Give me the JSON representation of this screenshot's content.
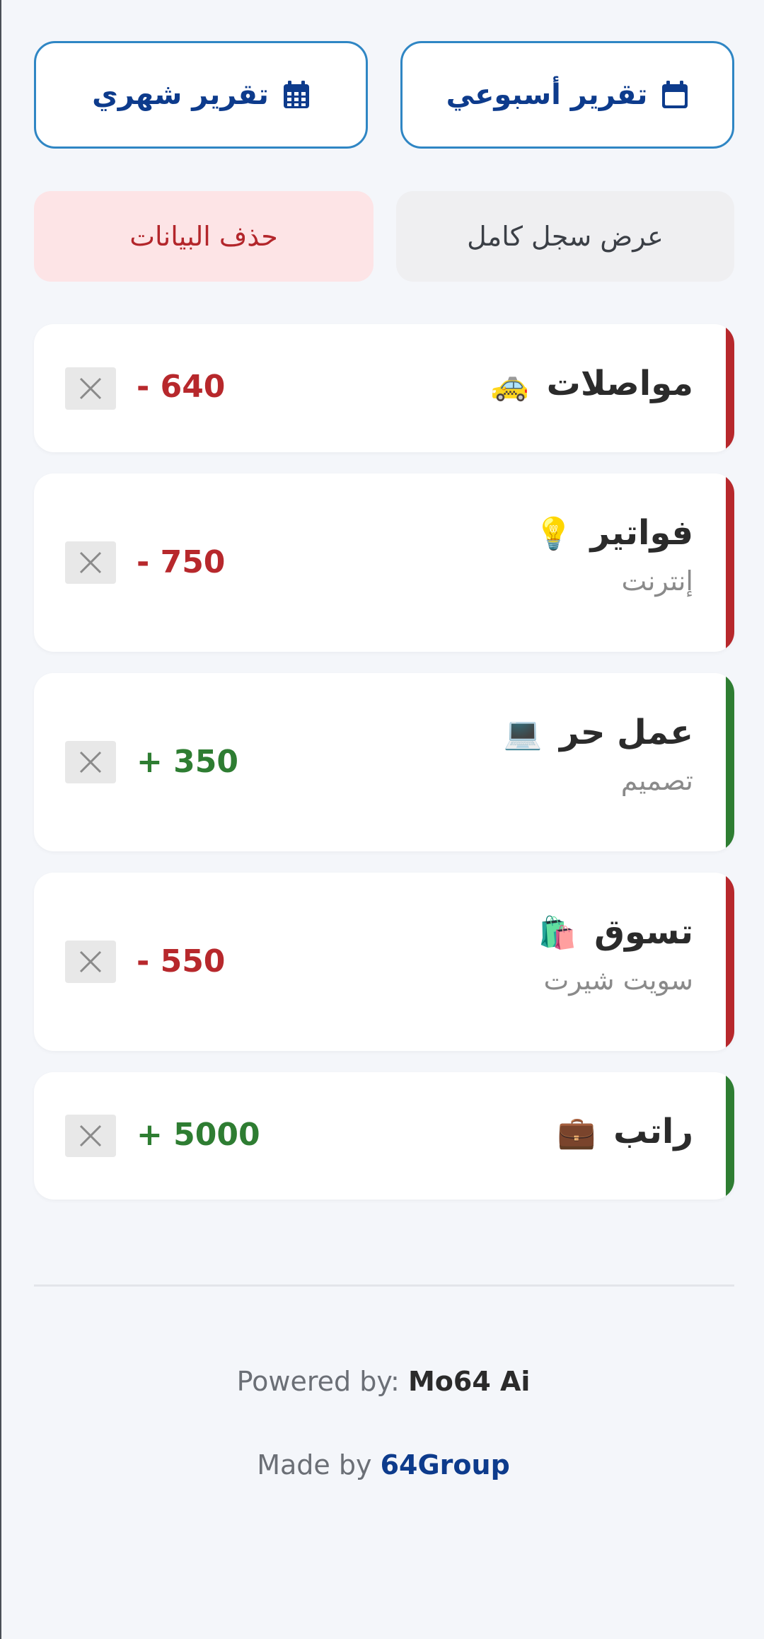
{
  "reports": {
    "weekly_label": "تقرير أسبوعي",
    "monthly_label": "تقرير شهري",
    "icon": "calendar-icon",
    "color": "#0d3b8c"
  },
  "actions": {
    "history_label": "عرض سجل كامل",
    "delete_label": "حذف البيانات"
  },
  "transactions": [
    {
      "title": "مواصلات",
      "emoji": "🚕",
      "note": "",
      "amount": "- 640",
      "type": "expense"
    },
    {
      "title": "فواتير",
      "emoji": "💡",
      "note": "إنترنت",
      "amount": "- 750",
      "type": "expense"
    },
    {
      "title": "عمل حر",
      "emoji": "💻",
      "note": "تصميم",
      "amount": "+ 350",
      "type": "income"
    },
    {
      "title": "تسوق",
      "emoji": "🛍️",
      "note": "سويت شيرت",
      "amount": "- 550",
      "type": "expense"
    },
    {
      "title": "راتب",
      "emoji": "💼",
      "note": "",
      "amount": "+ 5000",
      "type": "income"
    }
  ],
  "colors": {
    "expense": "#b7282c",
    "income": "#2e7d32",
    "accent": "#2f86c4"
  },
  "footer": {
    "powered_prefix": "Powered by:",
    "powered_name": "Mo64 Ai",
    "made_prefix": "Made by",
    "made_name": "64Group"
  }
}
